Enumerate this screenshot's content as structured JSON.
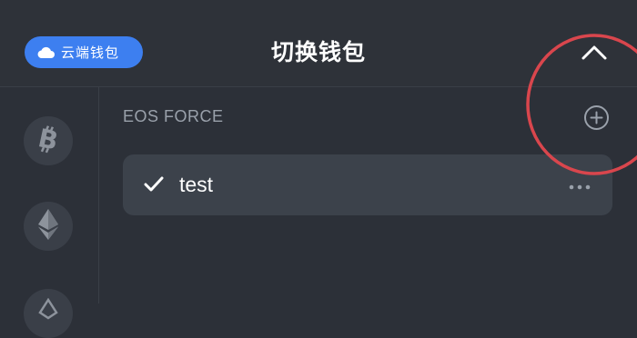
{
  "header": {
    "cloud_wallet_label": "云端钱包",
    "title": "切换钱包",
    "collapse_icon": "chevron-up-icon"
  },
  "sidebar": {
    "coins": [
      {
        "name": "bitcoin",
        "icon": "bitcoin-icon"
      },
      {
        "name": "ethereum",
        "icon": "ethereum-icon"
      },
      {
        "name": "third-coin",
        "icon": "coin-icon"
      }
    ]
  },
  "main": {
    "section_label": "EOS FORCE",
    "add_icon": "plus-circle-icon",
    "wallets": [
      {
        "name": "test",
        "selected": true
      }
    ]
  },
  "colors": {
    "background": "#2c3038",
    "accent": "#3d7ff0",
    "card": "#3c424b",
    "annotation": "#d9464d"
  }
}
